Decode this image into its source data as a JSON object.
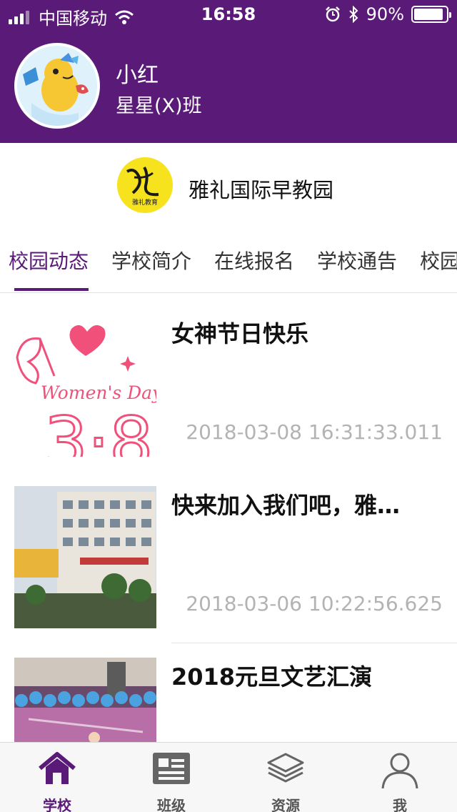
{
  "status_bar": {
    "carrier": "中国移动",
    "time": "16:58",
    "battery": "90%",
    "battery_level": 0.9
  },
  "profile": {
    "name": "小红",
    "class": "星星(X)班"
  },
  "school": {
    "name": "雅礼国际早教园",
    "logo_text": "雅礼教育"
  },
  "tabs": [
    {
      "label": "校园动态",
      "active": true
    },
    {
      "label": "学校简介",
      "active": false
    },
    {
      "label": "在线报名",
      "active": false
    },
    {
      "label": "学校通告",
      "active": false
    },
    {
      "label": "校园",
      "active": false
    }
  ],
  "news": [
    {
      "title": "女神节日快乐",
      "time": "2018-03-08 16:31:33.011",
      "thumb_text": "Women's Day",
      "thumb_number": "3·8"
    },
    {
      "title": "快来加入我们吧，雅…",
      "time": "2018-03-06 10:22:56.625"
    },
    {
      "title": "2018元旦文艺汇演",
      "time": ""
    }
  ],
  "bottom_nav": [
    {
      "label": "学校",
      "icon": "home-icon",
      "active": true
    },
    {
      "label": "班级",
      "icon": "newspaper-icon",
      "active": false
    },
    {
      "label": "资源",
      "icon": "layers-icon",
      "active": false
    },
    {
      "label": "我",
      "icon": "user-icon",
      "active": false
    }
  ],
  "colors": {
    "primary": "#5a1a78",
    "pink": "#f0507a",
    "time_gray": "#b3b3b3"
  }
}
